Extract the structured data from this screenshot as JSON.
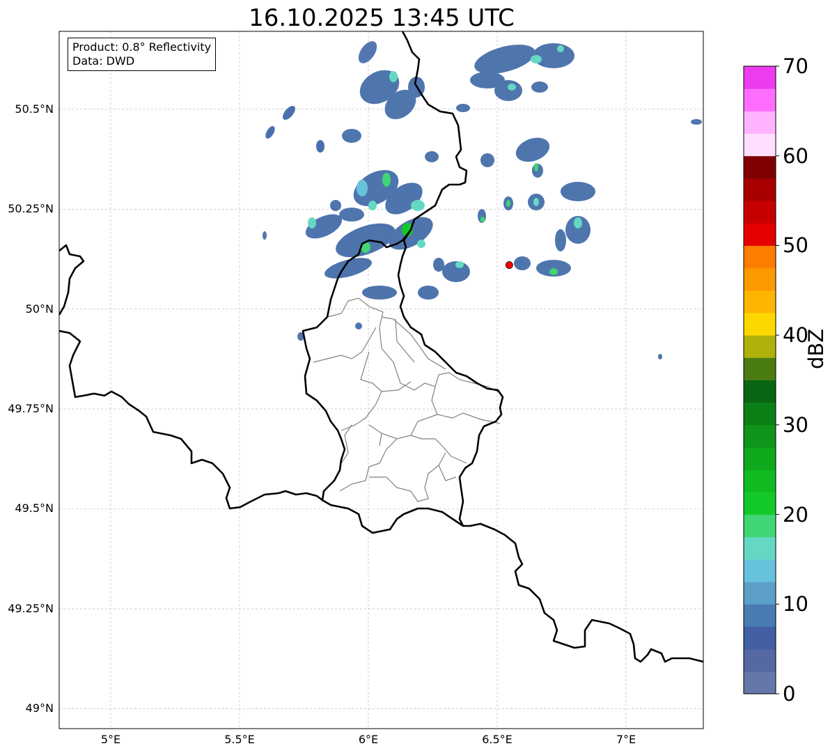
{
  "title": "16.10.2025 13:45 UTC",
  "info": {
    "product": "Product: 0.8° Reflectivity",
    "data": "Data: DWD"
  },
  "axes": {
    "lon_range": [
      4.8,
      7.3
    ],
    "lat_range": [
      48.95,
      50.695
    ],
    "x_ticks": [
      "5°E",
      "5.5°E",
      "6°E",
      "6.5°E",
      "7°E"
    ],
    "y_ticks": [
      "49°N",
      "49.25°N",
      "49.5°N",
      "49.75°N",
      "50°N",
      "50.25°N",
      "50.5°N"
    ],
    "grid": true
  },
  "marker": {
    "lon": 6.547,
    "lat": 50.11,
    "color": "#ff0000"
  },
  "colorbar": {
    "label": "dBZ",
    "ticks": [
      "0",
      "10",
      "20",
      "30",
      "40",
      "50",
      "60",
      "70"
    ],
    "range": [
      0,
      70
    ],
    "colors": [
      "#6577a8",
      "#5468a2",
      "#425fa3",
      "#4a7ab2",
      "#5b9fc8",
      "#67c3dc",
      "#65d8c4",
      "#3fd673",
      "#13c92a",
      "#11bb22",
      "#10a81d",
      "#0e951a",
      "#0c8016",
      "#096612",
      "#4b7c13",
      "#aeb20b",
      "#fdd800",
      "#fcb500",
      "#fd9900",
      "#fd7d00",
      "#e40000",
      "#c60000",
      "#a80000",
      "#7f0000",
      "#ffdeff",
      "#ffb3ff",
      "#ff6dff",
      "#ec3cee"
    ]
  },
  "chart_data": {
    "type": "heatmap",
    "title": "16.10.2025 13:45 UTC",
    "xlabel": "",
    "ylabel": "",
    "xlim": [
      4.8,
      7.3
    ],
    "ylim": [
      48.95,
      50.695
    ],
    "colorbar_label": "dBZ",
    "colorbar_range": [
      0,
      70
    ],
    "echo_cells": [
      {
        "lon": 5.75,
        "lat": 50.52,
        "dbz": 5
      },
      {
        "lon": 5.85,
        "lat": 50.25,
        "dbz": 15
      },
      {
        "lon": 5.95,
        "lat": 50.6,
        "dbz": 10
      },
      {
        "lon": 6.02,
        "lat": 50.3,
        "dbz": 18
      },
      {
        "lon": 6.08,
        "lat": 50.25,
        "dbz": 22
      },
      {
        "lon": 6.1,
        "lat": 50.56,
        "dbz": 12
      },
      {
        "lon": 6.14,
        "lat": 50.22,
        "dbz": 25
      },
      {
        "lon": 6.2,
        "lat": 50.19,
        "dbz": 12
      },
      {
        "lon": 6.4,
        "lat": 50.1,
        "dbz": 14
      },
      {
        "lon": 6.5,
        "lat": 50.62,
        "dbz": 12
      },
      {
        "lon": 6.63,
        "lat": 50.38,
        "dbz": 14
      },
      {
        "lon": 6.66,
        "lat": 50.27,
        "dbz": 16
      },
      {
        "lon": 6.78,
        "lat": 50.22,
        "dbz": 15
      },
      {
        "lon": 6.74,
        "lat": 50.1,
        "dbz": 14
      },
      {
        "lon": 6.8,
        "lat": 50.67,
        "dbz": 10
      }
    ]
  }
}
